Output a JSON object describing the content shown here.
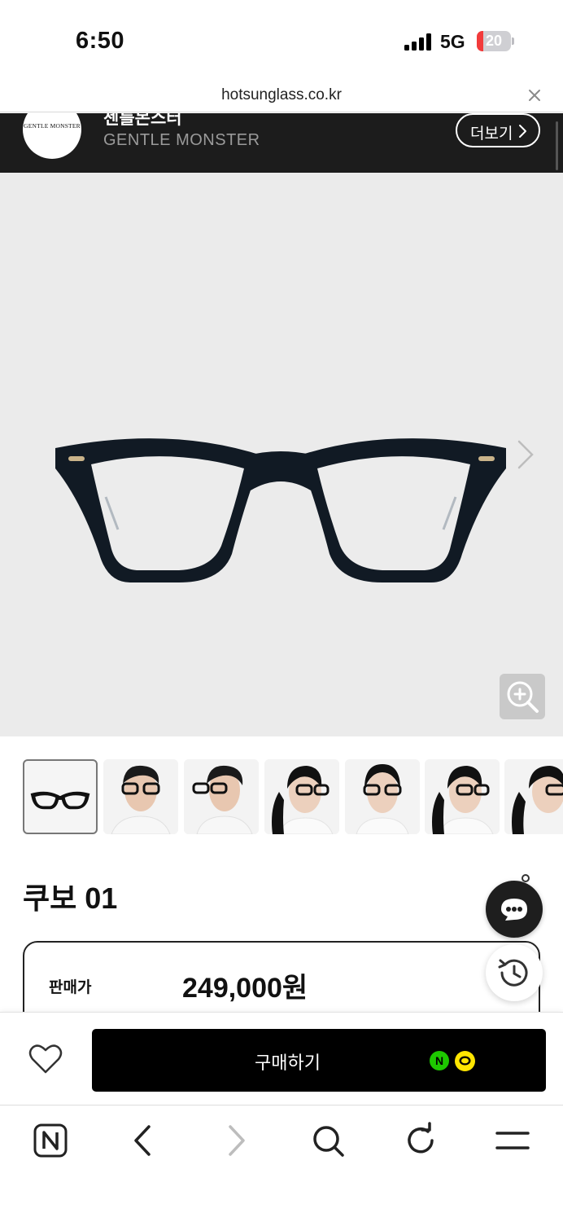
{
  "status_bar": {
    "time": "6:50",
    "network": "5G",
    "battery_level": "20",
    "battery_fraction": 0.2
  },
  "url_bar": {
    "domain": "hotsunglass.co.kr"
  },
  "brand": {
    "logo_text": "GENTLE MONSTER",
    "name_kr": "젠틀몬스터",
    "name_en": "GENTLE MONSTER",
    "more_label": "더보기"
  },
  "product": {
    "name": "쿠보 01",
    "price_label": "판매가",
    "price": "249,000원"
  },
  "thumbnails": [
    {
      "kind": "product",
      "selected": true
    },
    {
      "kind": "model-male-front",
      "selected": false
    },
    {
      "kind": "model-male-side",
      "selected": false
    },
    {
      "kind": "model-female-side",
      "selected": false
    },
    {
      "kind": "model-female-front",
      "selected": false
    },
    {
      "kind": "model-female-side",
      "selected": false
    },
    {
      "kind": "model-female-profile",
      "selected": false
    }
  ],
  "purchase": {
    "buy_label": "구매하기",
    "npay_mark": "N"
  },
  "colors": {
    "accent": "#000000",
    "header_bg": "#1c1c1c",
    "hero_bg": "#ebebeb",
    "npay": "#1ec800",
    "kakaopay": "#fee500",
    "battery_low": "#f23b3b"
  },
  "icons": {
    "close": "close-icon",
    "chevron": "chevron-right-icon",
    "zoom": "zoom-in-icon",
    "chat": "chat-icon",
    "recent": "history-icon",
    "wish": "heart-icon",
    "nav": [
      "naver-home-icon",
      "back-icon",
      "forward-icon",
      "search-icon",
      "refresh-icon",
      "menu-icon"
    ]
  }
}
